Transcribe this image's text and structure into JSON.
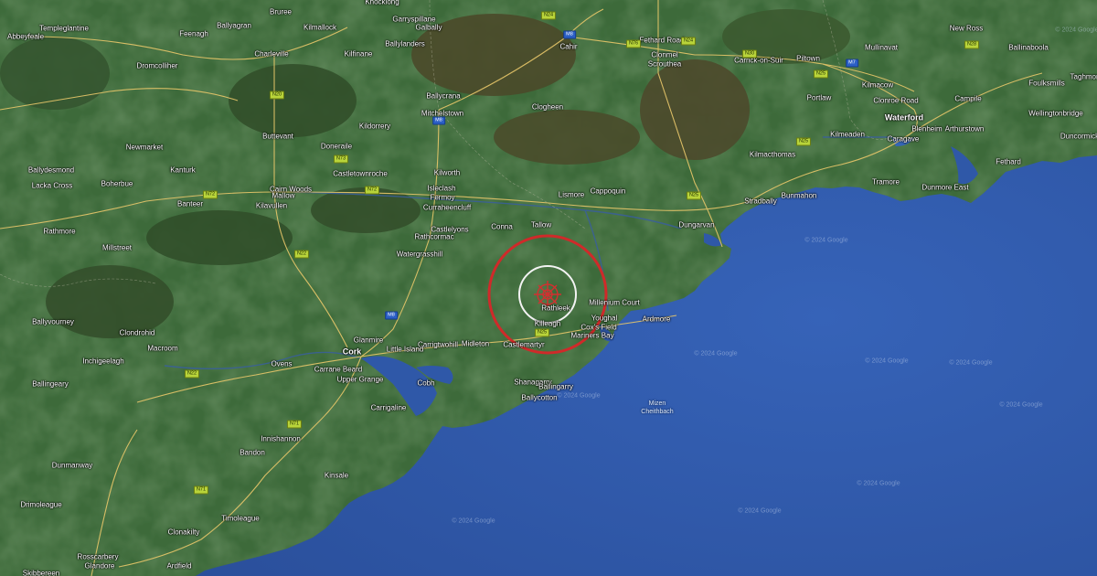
{
  "map": {
    "colors": {
      "sea": "#2f57a8",
      "land": "#3b6838",
      "accent_circle": "#d02626",
      "inner_circle": "#f1f1f1",
      "road": "#e6c86a",
      "badge": "#b9d43a",
      "motorway_badge": "#2b5fc6"
    },
    "epicenter_marker": {
      "name": "earthquake-epicenter",
      "icon": "epicenter-crosshair-icon"
    },
    "places": [
      {
        "name": "Abbeyfeale",
        "type": "town"
      },
      {
        "name": "Templeglantine",
        "type": "town"
      },
      {
        "name": "Feenagh",
        "type": "town"
      },
      {
        "name": "Ballyagran",
        "type": "town"
      },
      {
        "name": "Bruree",
        "type": "town"
      },
      {
        "name": "Kilmallock",
        "type": "town"
      },
      {
        "name": "Knocklong",
        "type": "town"
      },
      {
        "name": "Garryspillane",
        "type": "town"
      },
      {
        "name": "Galbally",
        "type": "town"
      },
      {
        "name": "Ballylanders",
        "type": "town"
      },
      {
        "name": "Kilfinane",
        "type": "town"
      },
      {
        "name": "Charleville",
        "type": "town"
      },
      {
        "name": "Dromcolliher",
        "type": "town"
      },
      {
        "name": "Cahir",
        "type": "town"
      },
      {
        "name": "Fethard Road",
        "type": "town"
      },
      {
        "name": "Clonmel",
        "type": "town"
      },
      {
        "name": "Scrouthea",
        "type": "town"
      },
      {
        "name": "Carrick-on-Suir",
        "type": "town"
      },
      {
        "name": "Piltown",
        "type": "town"
      },
      {
        "name": "Mullinavat",
        "type": "town"
      },
      {
        "name": "New Ross",
        "type": "town"
      },
      {
        "name": "Ballinaboola",
        "type": "town"
      },
      {
        "name": "Foulksmills",
        "type": "town"
      },
      {
        "name": "Taghmon",
        "type": "town"
      },
      {
        "name": "Ballycrana",
        "type": "town"
      },
      {
        "name": "Mitchelstown",
        "type": "town"
      },
      {
        "name": "Clogheen",
        "type": "town"
      },
      {
        "name": "Kilmacow",
        "type": "town"
      },
      {
        "name": "Portlaw",
        "type": "town"
      },
      {
        "name": "Clonroe Road",
        "type": "town"
      },
      {
        "name": "Waterford",
        "type": "city"
      },
      {
        "name": "Campile",
        "type": "town"
      },
      {
        "name": "Wellingtonbridge",
        "type": "town"
      },
      {
        "name": "Buttevant",
        "type": "town"
      },
      {
        "name": "Doneraile",
        "type": "town"
      },
      {
        "name": "Kildorrery",
        "type": "town"
      },
      {
        "name": "Kilmeaden",
        "type": "town"
      },
      {
        "name": "Blenheim",
        "type": "town"
      },
      {
        "name": "Arthurstown",
        "type": "town"
      },
      {
        "name": "Caragave",
        "type": "town"
      },
      {
        "name": "Duncormick",
        "type": "town"
      },
      {
        "name": "Newmarket",
        "type": "town"
      },
      {
        "name": "Kilmacthomas",
        "type": "town"
      },
      {
        "name": "Fethard",
        "type": "town"
      },
      {
        "name": "Ballydesmond",
        "type": "town"
      },
      {
        "name": "Kanturk",
        "type": "town"
      },
      {
        "name": "Castletownroche",
        "type": "town"
      },
      {
        "name": "Kilworth",
        "type": "town"
      },
      {
        "name": "Lacka Cross",
        "type": "town"
      },
      {
        "name": "Boherbue",
        "type": "town"
      },
      {
        "name": "Cairn Woods",
        "type": "town"
      },
      {
        "name": "Mallow",
        "type": "town"
      },
      {
        "name": "Kilavullen",
        "type": "town"
      },
      {
        "name": "Banteer",
        "type": "town"
      },
      {
        "name": "Isleclash",
        "type": "town"
      },
      {
        "name": "Fermoy",
        "type": "town"
      },
      {
        "name": "Curraheencluff",
        "type": "town"
      },
      {
        "name": "Lismore",
        "type": "town"
      },
      {
        "name": "Cappoquin",
        "type": "town"
      },
      {
        "name": "Tramore",
        "type": "town"
      },
      {
        "name": "Dunmore East",
        "type": "town"
      },
      {
        "name": "Stradbally",
        "type": "town"
      },
      {
        "name": "Bunmahon",
        "type": "town"
      },
      {
        "name": "Rathmore",
        "type": "town"
      },
      {
        "name": "Millstreet",
        "type": "town"
      },
      {
        "name": "Castlelyons",
        "type": "town"
      },
      {
        "name": "Rathcormac",
        "type": "town"
      },
      {
        "name": "Conna",
        "type": "town"
      },
      {
        "name": "Tallow",
        "type": "town"
      },
      {
        "name": "Dungarvan",
        "type": "town"
      },
      {
        "name": "Watergrasshill",
        "type": "town"
      },
      {
        "name": "Rathleek",
        "type": "town"
      },
      {
        "name": "Ballyvourney",
        "type": "town"
      },
      {
        "name": "Clondrohid",
        "type": "town"
      },
      {
        "name": "Millenium Court",
        "type": "town"
      },
      {
        "name": "Youghal",
        "type": "town"
      },
      {
        "name": "Killeagh",
        "type": "town"
      },
      {
        "name": "Cox's Field",
        "type": "town"
      },
      {
        "name": "Ardmore",
        "type": "town"
      },
      {
        "name": "Mariners Bay",
        "type": "town"
      },
      {
        "name": "Macroom",
        "type": "town"
      },
      {
        "name": "Glanmire",
        "type": "town"
      },
      {
        "name": "Carrigtwohill",
        "type": "town"
      },
      {
        "name": "Midleton",
        "type": "town"
      },
      {
        "name": "Castlemartyr",
        "type": "town"
      },
      {
        "name": "Cork",
        "type": "city"
      },
      {
        "name": "Little Island",
        "type": "town"
      },
      {
        "name": "Ballingeary",
        "type": "town"
      },
      {
        "name": "Ovens",
        "type": "town"
      },
      {
        "name": "Carrane Beard",
        "type": "town"
      },
      {
        "name": "Upper Grange",
        "type": "town"
      },
      {
        "name": "Cobh",
        "type": "town"
      },
      {
        "name": "Shanagarry",
        "type": "town"
      },
      {
        "name": "Ballingarry",
        "type": "town"
      },
      {
        "name": "Ballycotton",
        "type": "town"
      },
      {
        "name": "Carrigaline",
        "type": "town"
      },
      {
        "name": "Innishannon",
        "type": "town"
      },
      {
        "name": "Bandon",
        "type": "town"
      },
      {
        "name": "Dunmanway",
        "type": "town"
      },
      {
        "name": "Kinsale",
        "type": "town"
      },
      {
        "name": "Drimoleague",
        "type": "town"
      },
      {
        "name": "Timoleague",
        "type": "town"
      },
      {
        "name": "Clonakilty",
        "type": "town"
      },
      {
        "name": "Rosscarbery",
        "type": "town"
      },
      {
        "name": "Glandore",
        "type": "town"
      },
      {
        "name": "Ardfield",
        "type": "town"
      },
      {
        "name": "Skibbereen",
        "type": "town"
      },
      {
        "name": "Inchigeelagh",
        "type": "town"
      },
      {
        "name": "Mizen\nCheithbach",
        "type": "water"
      }
    ],
    "road_badges": [
      {
        "ref": "N24",
        "kind": "national"
      },
      {
        "ref": "M8",
        "kind": "motorway"
      },
      {
        "ref": "N76",
        "kind": "national"
      },
      {
        "ref": "N24",
        "kind": "national"
      },
      {
        "ref": "N30",
        "kind": "national"
      },
      {
        "ref": "N25",
        "kind": "national"
      },
      {
        "ref": "N20",
        "kind": "national"
      },
      {
        "ref": "M8",
        "kind": "motorway"
      },
      {
        "ref": "N73",
        "kind": "national"
      },
      {
        "ref": "N72",
        "kind": "national"
      },
      {
        "ref": "N72",
        "kind": "national"
      },
      {
        "ref": "N25",
        "kind": "national"
      },
      {
        "ref": "N22",
        "kind": "national"
      },
      {
        "ref": "M8",
        "kind": "motorway"
      },
      {
        "ref": "N25",
        "kind": "national"
      },
      {
        "ref": "N22",
        "kind": "national"
      },
      {
        "ref": "N71",
        "kind": "national"
      },
      {
        "ref": "N71",
        "kind": "national"
      },
      {
        "ref": "N28",
        "kind": "national"
      },
      {
        "ref": "M7",
        "kind": "motorway"
      },
      {
        "ref": "N25",
        "kind": "national"
      }
    ],
    "watermarks": [
      "© 2024 Google",
      "© 2024 Google",
      "© 2024 Google",
      "© 2024 Google",
      "© 2024 Google",
      "© 2024 Google",
      "© 2024 Google",
      "© 2024 Google",
      "© 2024 Google",
      "© 2024 Google"
    ]
  }
}
